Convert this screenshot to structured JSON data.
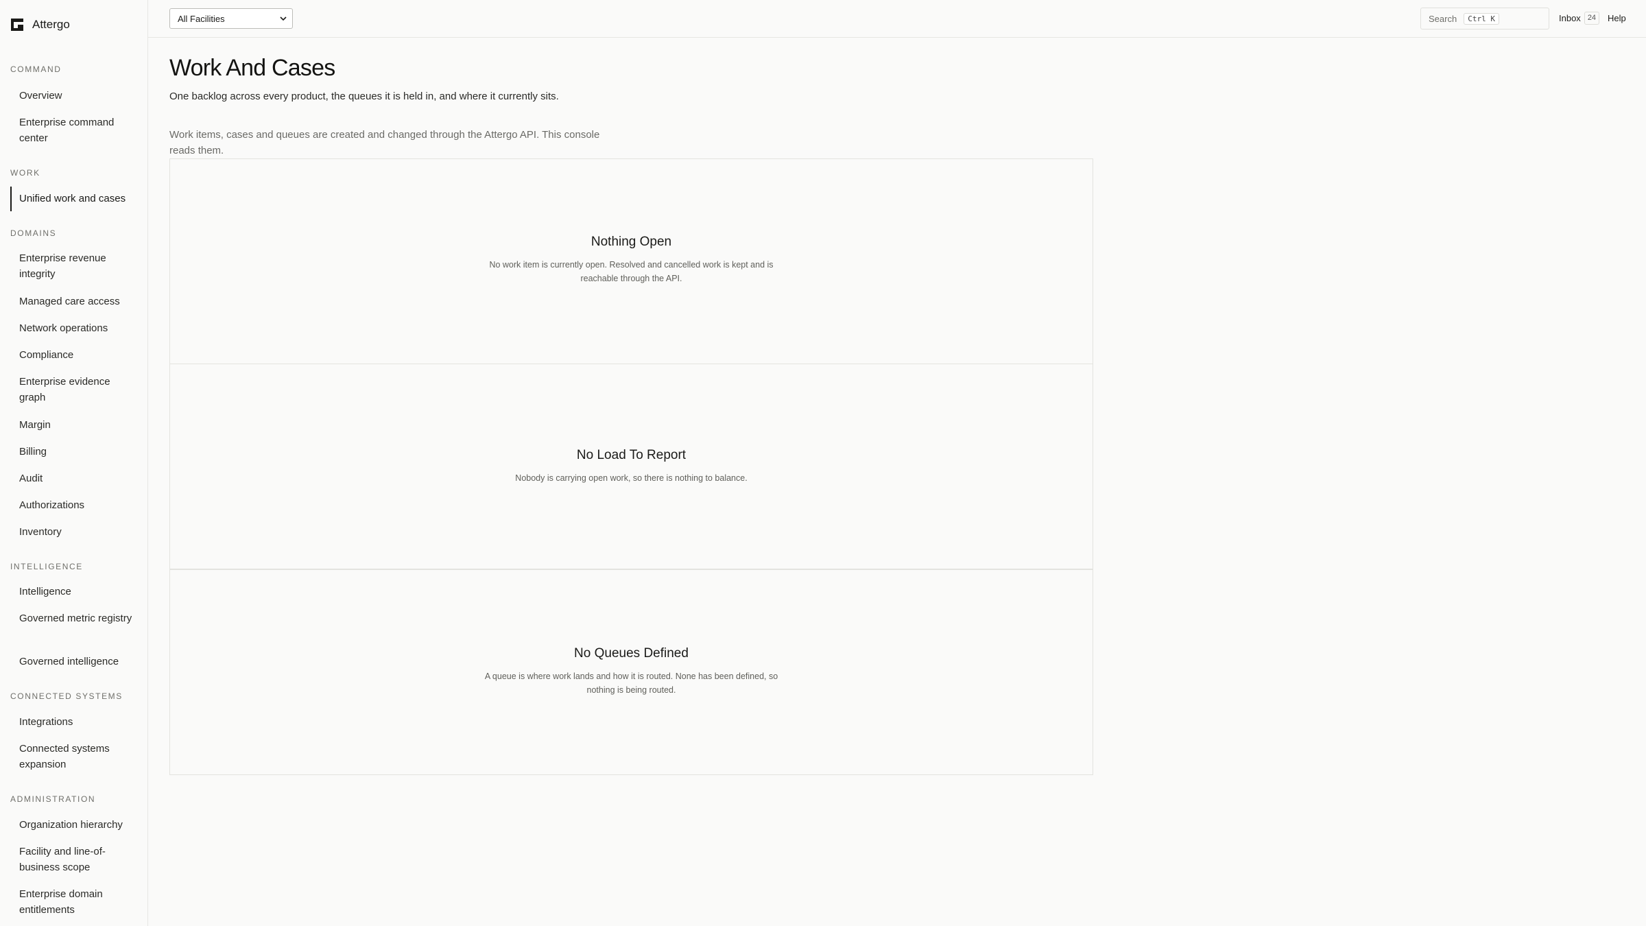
{
  "app": {
    "name": "Attergo"
  },
  "sidebar": {
    "sections": [
      {
        "label": "COMMAND",
        "items": [
          "Overview",
          "Enterprise command center"
        ]
      },
      {
        "label": "WORK",
        "items": [
          "Unified work and cases"
        ]
      },
      {
        "label": "DOMAINS",
        "items": [
          "Enterprise revenue integrity",
          "Managed care access",
          "Network operations",
          "Compliance",
          "Enterprise evidence graph",
          "Margin",
          "Billing",
          "Audit",
          "Authorizations",
          "Inventory"
        ]
      },
      {
        "label": "INTELLIGENCE",
        "items": [
          "Intelligence",
          "Governed metric registry",
          "Governed intelligence"
        ]
      },
      {
        "label": "CONNECTED SYSTEMS",
        "items": [
          "Integrations",
          "Connected systems expansion"
        ]
      },
      {
        "label": "ADMINISTRATION",
        "items": [
          "Organization hierarchy",
          "Facility and line-of-business scope",
          "Enterprise domain entitlements"
        ]
      }
    ],
    "active_item": "Unified work and cases"
  },
  "topbar": {
    "facility_selected": "All Facilities",
    "search_label": "Search",
    "search_shortcut": "Ctrl K",
    "inbox_label": "Inbox",
    "inbox_count": "24",
    "help_label": "Help"
  },
  "main": {
    "title": "Work And Cases",
    "subtitle": "One backlog across every product, the queues it is held in, and where it currently sits.",
    "api_note": "Work items, cases and queues are created and changed through the Attergo API. This console reads them.",
    "panels": [
      {
        "title": "Nothing Open",
        "text": "No work item is currently open. Resolved and cancelled work is kept and is reachable through the API."
      },
      {
        "title": "No Load To Report",
        "text": "Nobody is carrying open work, so there is nothing to balance."
      },
      {
        "title": "No Queues Defined",
        "text": "A queue is where work lands and how it is routed. None has been defined, so nothing is being routed."
      }
    ]
  },
  "colors": {
    "background": "#fafaf9",
    "text": "#1c1c1a",
    "border": "#e3e3df"
  }
}
